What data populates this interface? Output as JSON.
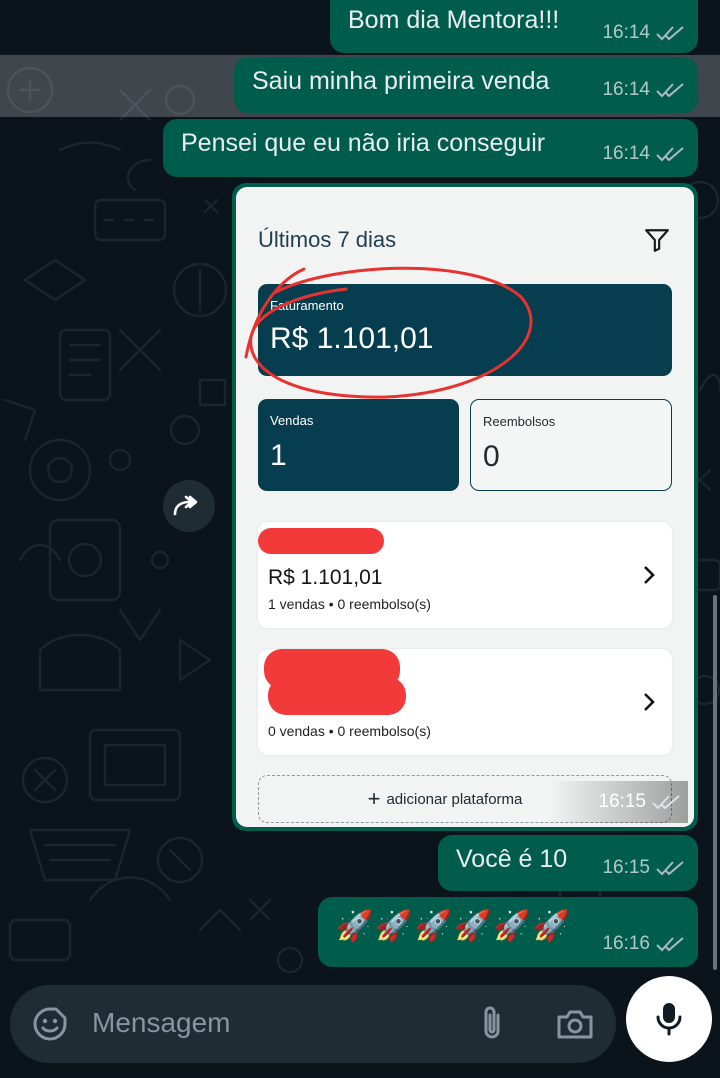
{
  "messages": [
    {
      "text": "Bom dia Mentora!!!",
      "time": "16:14"
    },
    {
      "text": "Saiu minha primeira venda",
      "time": "16:14"
    },
    {
      "text": "Pensei que eu não iria conseguir",
      "time": "16:14"
    },
    {
      "text": "Você é 10",
      "time": "16:15"
    },
    {
      "text": "🚀🚀🚀🚀🚀🚀",
      "time": "16:16"
    }
  ],
  "image_message": {
    "time": "16:15",
    "screenshot": {
      "title": "Últimos 7 dias",
      "faturamento_label": "Faturamento",
      "faturamento_value": "R$ 1.101,01",
      "vendas_label": "Vendas",
      "vendas_value": "1",
      "reembolsos_label": "Reembolsos",
      "reembolsos_value": "0",
      "platforms": [
        {
          "amount": "R$ 1.101,01",
          "summary": "1 vendas • 0 reembolso(s)"
        },
        {
          "amount": "",
          "summary": "0 vendas • 0 reembolso(s)"
        }
      ],
      "add_platform_label": "adicionar plataforma"
    }
  },
  "input": {
    "placeholder": "Mensagem"
  },
  "icons": {
    "forward": "forward-icon",
    "emoji": "sticker-emoji-icon",
    "attach": "paperclip-icon",
    "camera": "camera-icon",
    "mic": "microphone-icon",
    "filter": "filter-icon"
  },
  "colors": {
    "chat_bg": "#0b141a",
    "outgoing_bubble": "#005c4b",
    "input_bar": "#1f2c34",
    "card_dark": "#063d4f",
    "redaction": "#f23a3a",
    "annotation_circle": "#e8322f"
  }
}
